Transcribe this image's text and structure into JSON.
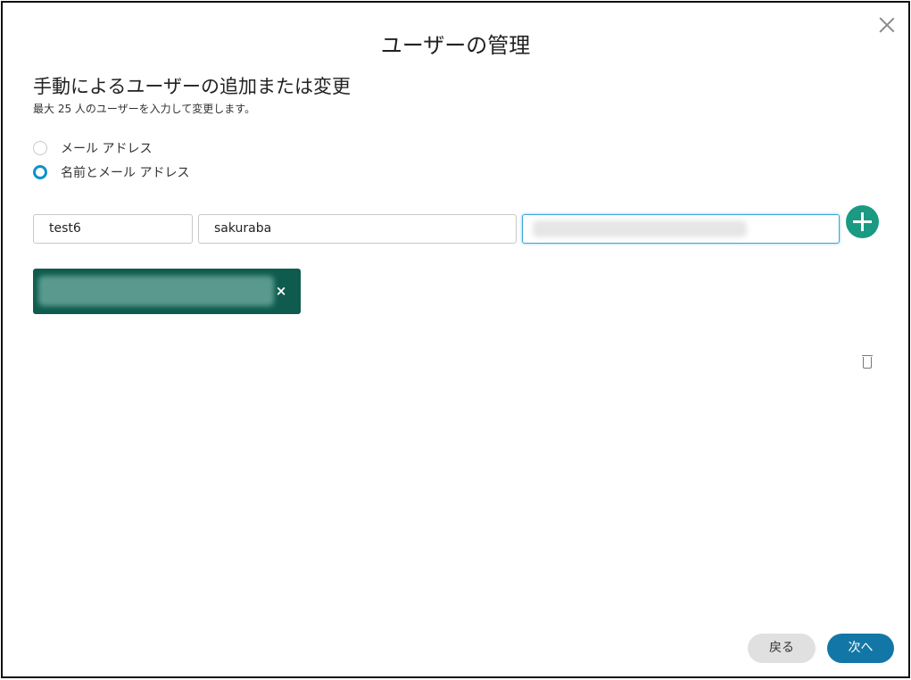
{
  "dialog": {
    "title": "ユーザーの管理",
    "section_title": "手動によるユーザーの追加または変更",
    "section_subtitle": "最大 25 人のユーザーを入力して変更します。"
  },
  "radio_options": [
    {
      "label": "メール アドレス",
      "selected": false
    },
    {
      "label": "名前とメール アドレス",
      "selected": true
    }
  ],
  "form": {
    "first_name_value": "test6",
    "last_name_value": "sakuraba",
    "email_value": ""
  },
  "colors": {
    "accent": "#0d93c9",
    "add_button": "#1a9a82",
    "chip": "#0f5c4e",
    "next_button": "#1277a6",
    "back_button": "#e0e0e0"
  },
  "chip": {
    "remove_symbol": "×"
  },
  "buttons": {
    "back_label": "戻る",
    "next_label": "次へ"
  },
  "icons": {
    "close": "close-icon",
    "add": "plus-icon",
    "remove": "close-icon",
    "delete": "trash-icon"
  }
}
